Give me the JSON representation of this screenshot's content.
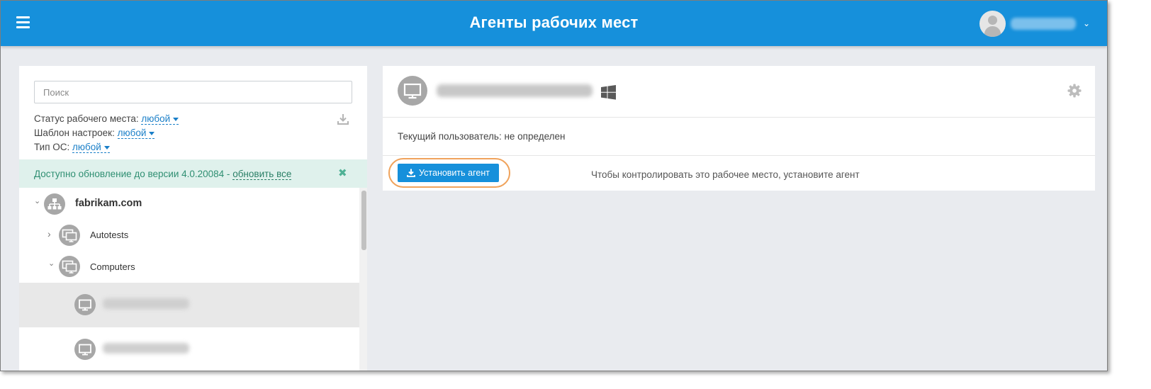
{
  "header": {
    "title": "Агенты рабочих мест",
    "menu_icon": "hamburger-icon",
    "user_avatar_icon": "user-icon",
    "user_chevron": "⌄"
  },
  "left_panel": {
    "search": {
      "placeholder": "Поиск",
      "value": ""
    },
    "filters": [
      {
        "label": "Статус рабочего места:",
        "value": "любой"
      },
      {
        "label": "Шаблон настроек:",
        "value": "любой"
      },
      {
        "label": "Тип ОС:",
        "value": "любой"
      }
    ],
    "export_icon": "download-icon",
    "update_banner": {
      "text": "Доступно обновление до версии 4.0.20084 - ",
      "link": "обновить все",
      "close": "✖"
    },
    "tree": {
      "root": {
        "label": "fabrikam.com",
        "expanded": true,
        "icon": "domain-icon",
        "chevron": "⌄"
      },
      "groups": [
        {
          "label": "Autotests",
          "expanded": false,
          "icon": "workstation-group-icon",
          "chevron": "›"
        },
        {
          "label": "Computers",
          "expanded": true,
          "icon": "workstation-group-icon",
          "chevron": "⌄"
        }
      ],
      "computers": [
        {
          "selected": true,
          "icon": "computer-icon"
        },
        {
          "selected": false,
          "icon": "computer-icon"
        }
      ]
    }
  },
  "right_panel": {
    "os_icon": "windows-icon",
    "settings_icon": "gear-icon",
    "current_user": "Текущий пользователь: не определен",
    "install_button": "Установить агент",
    "install_hint": "Чтобы контролировать это рабочее место, установите агент",
    "highlight_color": "#f0a35c"
  },
  "colors": {
    "accent": "#1690db",
    "update_banner_bg": "#dff1ec",
    "update_banner_text": "#2f8f72",
    "page_bg": "#e9ebef"
  }
}
